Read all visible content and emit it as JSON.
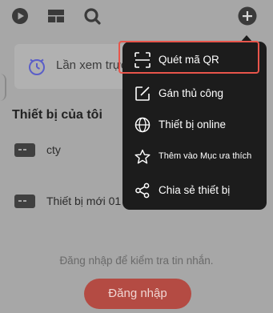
{
  "toolbar": {
    "icons": [
      "play-icon",
      "layout-icon",
      "search-icon",
      "add-icon"
    ]
  },
  "recent": {
    "label": "Lần xem trực tiếp gần đây",
    "chevron": ">"
  },
  "devices_section": {
    "title": "Thiết bị của tôi",
    "items": [
      {
        "name": "cty",
        "chevron": "⌄"
      },
      {
        "name": "Thiết bị mới 01",
        "chevron": "⌄"
      }
    ]
  },
  "login": {
    "message": "Đăng nhập để kiểm tra tin nhắn.",
    "button_label": "Đăng nhập"
  },
  "menu": {
    "items": [
      {
        "label": "Quét mã QR",
        "icon": "qr-scan-icon"
      },
      {
        "label": "Gán thủ công",
        "icon": "edit-icon"
      },
      {
        "label": "Thiết bị online",
        "icon": "globe-icon"
      },
      {
        "label": "Thêm vào Mục ưa thích",
        "icon": "star-icon"
      },
      {
        "label": "Chia sẻ thiết bị",
        "icon": "share-icon"
      }
    ],
    "highlighted_item": "Quét mã QR",
    "highlight_color": "#e8554b"
  },
  "colors": {
    "overlay": "#a7a7a7",
    "menu_bg": "#1c1c1c",
    "login_button": "#b44b43"
  }
}
